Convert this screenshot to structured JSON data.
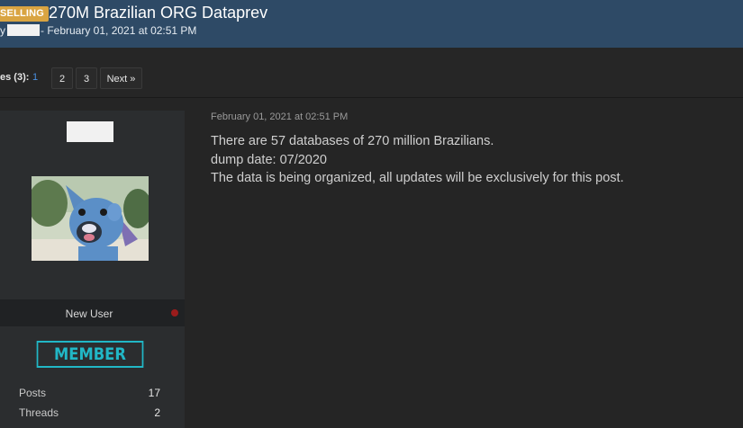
{
  "thread": {
    "prefix": "SELLING",
    "title": "270M Brazilian ORG Dataprev",
    "by_prefix": "y",
    "byline_date": "- February 01, 2021 at 02:51 PM"
  },
  "pagination": {
    "label": "es (3):",
    "current": "1",
    "pages": [
      "2",
      "3"
    ],
    "next": "Next »"
  },
  "author": {
    "user_title": "New User",
    "rank": "MEMBER",
    "stats": [
      {
        "label": "Posts",
        "value": "17"
      },
      {
        "label": "Threads",
        "value": "2"
      }
    ],
    "status_color": "#9b1c1c"
  },
  "post": {
    "date": "February 01, 2021 at 02:51 PM",
    "lines": [
      "There are 57 databases of 270 million Brazilians.",
      "dump date: 07/2020",
      "The data is being organized, all updates will be exclusively for this post."
    ]
  },
  "colors": {
    "header_bg": "#2e4a66",
    "badge_bg": "#d9a441",
    "rank_color": "#21b7c6",
    "link_color": "#4a90e2"
  }
}
